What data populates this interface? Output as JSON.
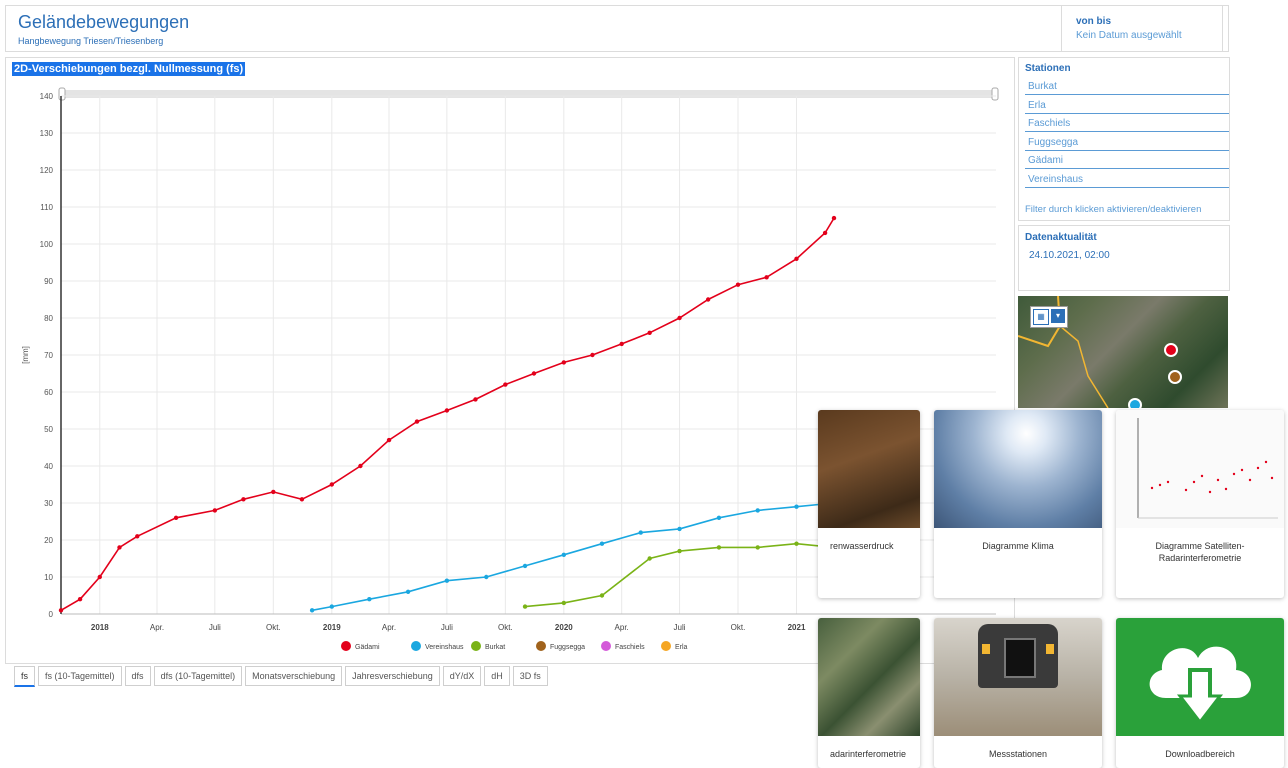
{
  "header": {
    "title": "Geländebewegungen",
    "subtitle": "Hangbewegung Triesen/Triesenberg",
    "date_label": "von bis",
    "date_value": "Kein Datum ausgewählt"
  },
  "chart": {
    "title": "2D-Verschiebungen bezgl. Nullmessung (fs)"
  },
  "chart_data": {
    "type": "line",
    "ylabel": "[mm]",
    "ylim": [
      0,
      140
    ],
    "yticks": [
      0,
      10,
      20,
      30,
      40,
      50,
      60,
      70,
      80,
      90,
      100,
      110,
      120,
      130,
      140
    ],
    "xlim": [
      "2017-11-01",
      "2021-03-01"
    ],
    "xticks": [
      {
        "label": "2018",
        "date": "2018-01-01",
        "bold": true
      },
      {
        "label": "Apr.",
        "date": "2018-04-01"
      },
      {
        "label": "Juli",
        "date": "2018-07-01"
      },
      {
        "label": "Okt.",
        "date": "2018-10-01"
      },
      {
        "label": "2019",
        "date": "2019-01-01",
        "bold": true
      },
      {
        "label": "Apr.",
        "date": "2019-04-01"
      },
      {
        "label": "Juli",
        "date": "2019-07-01"
      },
      {
        "label": "Okt.",
        "date": "2019-10-01"
      },
      {
        "label": "2020",
        "date": "2020-01-01",
        "bold": true
      },
      {
        "label": "Apr.",
        "date": "2020-04-01"
      },
      {
        "label": "Juli",
        "date": "2020-07-01"
      },
      {
        "label": "Okt.",
        "date": "2020-10-01"
      },
      {
        "label": "2021",
        "date": "2021-01-01",
        "bold": true
      }
    ],
    "series": [
      {
        "name": "Gädami",
        "color": "#e3001b",
        "points": [
          [
            "2017-11-01",
            1
          ],
          [
            "2017-12-01",
            4
          ],
          [
            "2018-01-01",
            10
          ],
          [
            "2018-02-01",
            18
          ],
          [
            "2018-03-01",
            21
          ],
          [
            "2018-05-01",
            26
          ],
          [
            "2018-07-01",
            28
          ],
          [
            "2018-08-15",
            31
          ],
          [
            "2018-10-01",
            33
          ],
          [
            "2018-11-15",
            31
          ],
          [
            "2019-01-01",
            35
          ],
          [
            "2019-02-15",
            40
          ],
          [
            "2019-04-01",
            47
          ],
          [
            "2019-05-15",
            52
          ],
          [
            "2019-07-01",
            55
          ],
          [
            "2019-08-15",
            58
          ],
          [
            "2019-10-01",
            62
          ],
          [
            "2019-11-15",
            65
          ],
          [
            "2020-01-01",
            68
          ],
          [
            "2020-02-15",
            70
          ],
          [
            "2020-04-01",
            73
          ],
          [
            "2020-05-15",
            76
          ],
          [
            "2020-07-01",
            80
          ],
          [
            "2020-08-15",
            85
          ],
          [
            "2020-10-01",
            89
          ],
          [
            "2020-11-15",
            91
          ],
          [
            "2021-01-01",
            96
          ],
          [
            "2021-02-15",
            103
          ],
          [
            "2021-03-01",
            107
          ]
        ]
      },
      {
        "name": "Vereinshaus",
        "color": "#1aa7e0",
        "points": [
          [
            "2018-12-01",
            1
          ],
          [
            "2019-01-01",
            2
          ],
          [
            "2019-03-01",
            4
          ],
          [
            "2019-05-01",
            6
          ],
          [
            "2019-07-01",
            9
          ],
          [
            "2019-09-01",
            10
          ],
          [
            "2019-11-01",
            13
          ],
          [
            "2020-01-01",
            16
          ],
          [
            "2020-03-01",
            19
          ],
          [
            "2020-05-01",
            22
          ],
          [
            "2020-07-01",
            23
          ],
          [
            "2020-09-01",
            26
          ],
          [
            "2020-11-01",
            28
          ],
          [
            "2021-01-01",
            29
          ],
          [
            "2021-03-01",
            30
          ]
        ]
      },
      {
        "name": "Burkat",
        "color": "#7ab317",
        "points": [
          [
            "2019-11-01",
            2
          ],
          [
            "2020-01-01",
            3
          ],
          [
            "2020-03-01",
            5
          ],
          [
            "2020-05-15",
            15
          ],
          [
            "2020-07-01",
            17
          ],
          [
            "2020-09-01",
            18
          ],
          [
            "2020-11-01",
            18
          ],
          [
            "2021-01-01",
            19
          ],
          [
            "2021-03-01",
            18
          ]
        ]
      },
      {
        "name": "Fuggsegga",
        "color": "#a0621c",
        "points": []
      },
      {
        "name": "Faschiels",
        "color": "#d45ad9",
        "points": []
      },
      {
        "name": "Erla",
        "color": "#f5a623",
        "points": []
      }
    ]
  },
  "tabs": [
    "fs",
    "fs (10-Tagemittel)",
    "dfs",
    "dfs (10-Tagemittel)",
    "Monatsverschiebung",
    "Jahresverschiebung",
    "dY/dX",
    "dH",
    "3D fs"
  ],
  "stations": {
    "title": "Stationen",
    "items": [
      "Burkat",
      "Erla",
      "Faschiels",
      "Fuggsegga",
      "Gädami",
      "Vereinshaus"
    ],
    "hint": "Filter durch klicken aktivieren/deaktivieren"
  },
  "actuality": {
    "title": "Datenaktualität",
    "value": "24.10.2021, 02:00"
  },
  "cards": [
    "renwasserdruck",
    "Diagramme Klima",
    "Diagramme Satelliten-Radarinterferometrie",
    "adarinterferometrie",
    "Messstationen",
    "Downloadbereich"
  ]
}
